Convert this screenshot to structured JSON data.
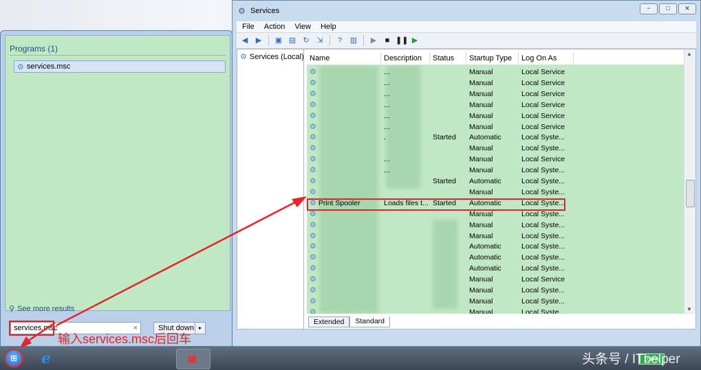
{
  "services_window": {
    "title": "Services",
    "controls": [
      "−",
      "□",
      "✕"
    ],
    "menu": [
      "File",
      "Action",
      "View",
      "Help"
    ],
    "tree_item": "Services (Local)",
    "columns": [
      "Name",
      "Description",
      "Status",
      "Startup Type",
      "Log On As"
    ],
    "rows": [
      {
        "name": "",
        "desc": "...",
        "status": "",
        "type": "Manual",
        "logon": "Local Service"
      },
      {
        "name": "",
        "desc": "...",
        "status": "",
        "type": "Manual",
        "logon": "Local Service"
      },
      {
        "name": "",
        "desc": "...",
        "status": "",
        "type": "Manual",
        "logon": "Local Service"
      },
      {
        "name": "",
        "desc": "...",
        "status": "",
        "type": "Manual",
        "logon": "Local Service"
      },
      {
        "name": "",
        "desc": "...",
        "status": "",
        "type": "Manual",
        "logon": "Local Service"
      },
      {
        "name": "",
        "desc": "...",
        "status": "",
        "type": "Manual",
        "logon": "Local Service"
      },
      {
        "name": "",
        "desc": ".",
        "status": "Started",
        "type": "Automatic",
        "logon": "Local Syste..."
      },
      {
        "name": "",
        "desc": "",
        "status": "",
        "type": "Manual",
        "logon": "Local Syste..."
      },
      {
        "name": "",
        "desc": "...",
        "status": "",
        "type": "Manual",
        "logon": "Local Service"
      },
      {
        "name": "",
        "desc": "...",
        "status": "",
        "type": "Manual",
        "logon": "Local Syste..."
      },
      {
        "name": "",
        "desc": "",
        "status": "Started",
        "type": "Automatic",
        "logon": "Local Syste..."
      },
      {
        "name": "",
        "desc": "",
        "status": "",
        "type": "Manual",
        "logon": "Local Syste..."
      },
      {
        "name": "Print Spooler",
        "desc": "Loads files t...",
        "status": "Started",
        "type": "Automatic",
        "logon": "Local Syste..."
      },
      {
        "name": "",
        "desc": "",
        "status": "",
        "type": "Manual",
        "logon": "Local Syste..."
      },
      {
        "name": "",
        "desc": "",
        "status": "",
        "type": "Manual",
        "logon": "Local Syste..."
      },
      {
        "name": "",
        "desc": "",
        "status": "",
        "type": "Manual",
        "logon": "Local Syste..."
      },
      {
        "name": "",
        "desc": "",
        "status": "",
        "type": "Automatic",
        "logon": "Local Syste..."
      },
      {
        "name": "",
        "desc": "",
        "status": "",
        "type": "Automatic",
        "logon": "Local Syste..."
      },
      {
        "name": "",
        "desc": "",
        "status": "",
        "type": "Automatic",
        "logon": "Local Syste..."
      },
      {
        "name": "",
        "desc": "",
        "status": "",
        "type": "Manual",
        "logon": "Local Service"
      },
      {
        "name": "",
        "desc": "",
        "status": "",
        "type": "Manual",
        "logon": "Local Syste..."
      },
      {
        "name": "",
        "desc": "",
        "status": "",
        "type": "Manual",
        "logon": "Local Syste..."
      },
      {
        "name": "",
        "desc": "",
        "status": "",
        "type": "Manual",
        "logon": "Local Syste..."
      }
    ],
    "tabs": [
      "Extended",
      "Standard"
    ]
  },
  "start_menu": {
    "programs_heading": "Programs (1)",
    "result": "services.msc",
    "see_more": "See more results",
    "search_value": "services.msc",
    "search_clear": "×",
    "shutdown_label": "Shut down",
    "shutdown_arrow": "▸"
  },
  "annotation": "输入services.msc后回车",
  "taskbar": {
    "battery": "100%",
    "watermark": "头条号 / ITbelper"
  },
  "colors": {
    "highlight": "#e6232a",
    "list_bg": "#c1e8c4"
  }
}
